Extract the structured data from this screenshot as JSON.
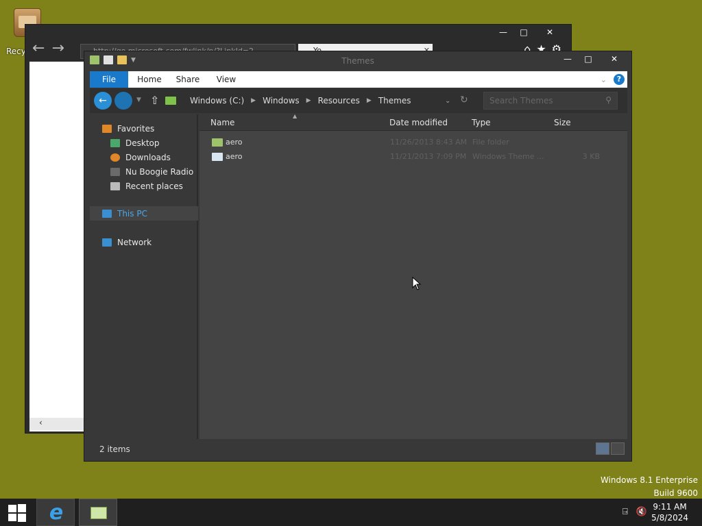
{
  "desktop": {
    "recycle_bin_label": "Recy",
    "watermark_line1": "Windows 8.1 Enterprise",
    "watermark_line2": "Build 9600"
  },
  "ie_window": {
    "address": "http://go.microsoft.com/fwlink/p/?LinkId=2",
    "tab_title": "Yo..."
  },
  "explorer": {
    "title": "Themes",
    "ribbon": {
      "file": "File",
      "home": "Home",
      "share": "Share",
      "view": "View"
    },
    "breadcrumb": [
      "Windows (C:)",
      "Windows",
      "Resources",
      "Themes"
    ],
    "search_placeholder": "Search Themes",
    "nav": {
      "favorites": "Favorites",
      "desktop": "Desktop",
      "downloads": "Downloads",
      "radio": "Nu Boogie Radio",
      "recent": "Recent places",
      "this_pc": "This PC",
      "network": "Network"
    },
    "columns": {
      "name": "Name",
      "date": "Date modified",
      "type": "Type",
      "size": "Size"
    },
    "rows": [
      {
        "name": "aero",
        "date": "11/26/2013 8:43 AM",
        "type": "File folder",
        "size": ""
      },
      {
        "name": "aero",
        "date": "11/21/2013 7:09 PM",
        "type": "Windows Theme ...",
        "size": "3 KB"
      }
    ],
    "status_count": "2 items"
  },
  "taskbar": {
    "time": "9:11 AM",
    "date": "5/8/2024"
  },
  "colors": {
    "desktop_bg": "#7f8119",
    "accent": "#1979ca",
    "selection_text": "#4aa8ea"
  }
}
